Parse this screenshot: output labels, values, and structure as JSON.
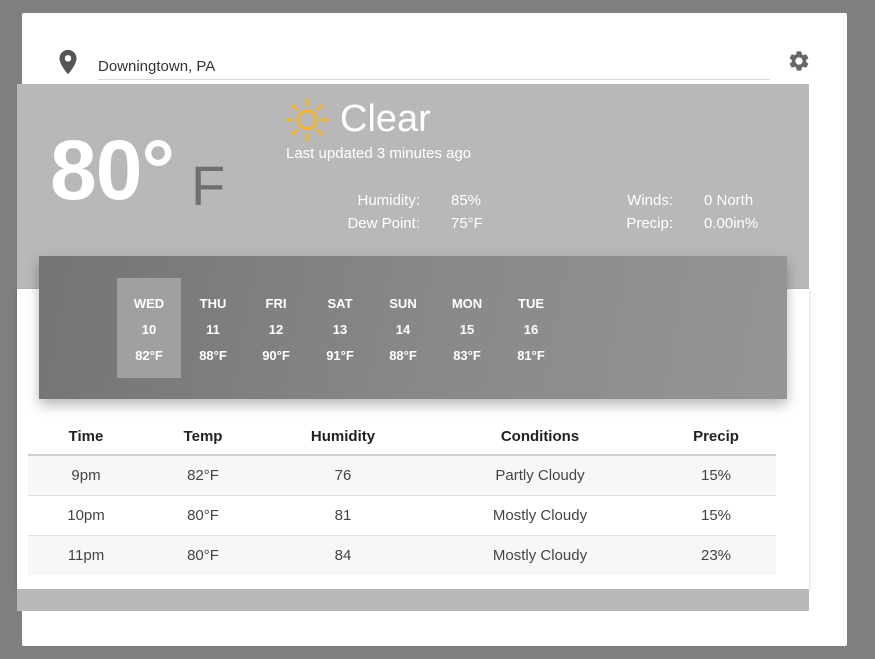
{
  "location": {
    "value": "Downingtown, PA"
  },
  "current": {
    "temp": "80°",
    "unit": "F",
    "condition": "Clear",
    "updated": "Last updated 3 minutes ago"
  },
  "stats": {
    "humidity_label": "Humidity:",
    "humidity_value": "85%",
    "dew_label": "Dew Point:",
    "dew_value": "75°F",
    "winds_label": "Winds:",
    "winds_value": "0 North",
    "precip_label": "Precip:",
    "precip_value": "0.00in%"
  },
  "forecast": [
    {
      "day": "WED",
      "date": "10",
      "temp": "82°F",
      "selected": true
    },
    {
      "day": "THU",
      "date": "11",
      "temp": "88°F",
      "selected": false
    },
    {
      "day": "FRI",
      "date": "12",
      "temp": "90°F",
      "selected": false
    },
    {
      "day": "SAT",
      "date": "13",
      "temp": "91°F",
      "selected": false
    },
    {
      "day": "SUN",
      "date": "14",
      "temp": "88°F",
      "selected": false
    },
    {
      "day": "MON",
      "date": "15",
      "temp": "83°F",
      "selected": false
    },
    {
      "day": "TUE",
      "date": "16",
      "temp": "81°F",
      "selected": false
    }
  ],
  "hourly": {
    "headers": [
      "Time",
      "Temp",
      "Humidity",
      "Conditions",
      "Precip"
    ],
    "rows": [
      [
        "9pm",
        "82°F",
        "76",
        "Partly Cloudy",
        "15%"
      ],
      [
        "10pm",
        "80°F",
        "81",
        "Mostly Cloudy",
        "15%"
      ],
      [
        "11pm",
        "80°F",
        "84",
        "Mostly Cloudy",
        "23%"
      ]
    ]
  },
  "icons": {
    "location": "map-pin-icon",
    "settings": "gear-icon",
    "weather": "sun-icon"
  },
  "colors": {
    "hero_bg": "#b8b8b8",
    "sun": "#f5b52e",
    "page_bg": "#7f7f7f"
  }
}
